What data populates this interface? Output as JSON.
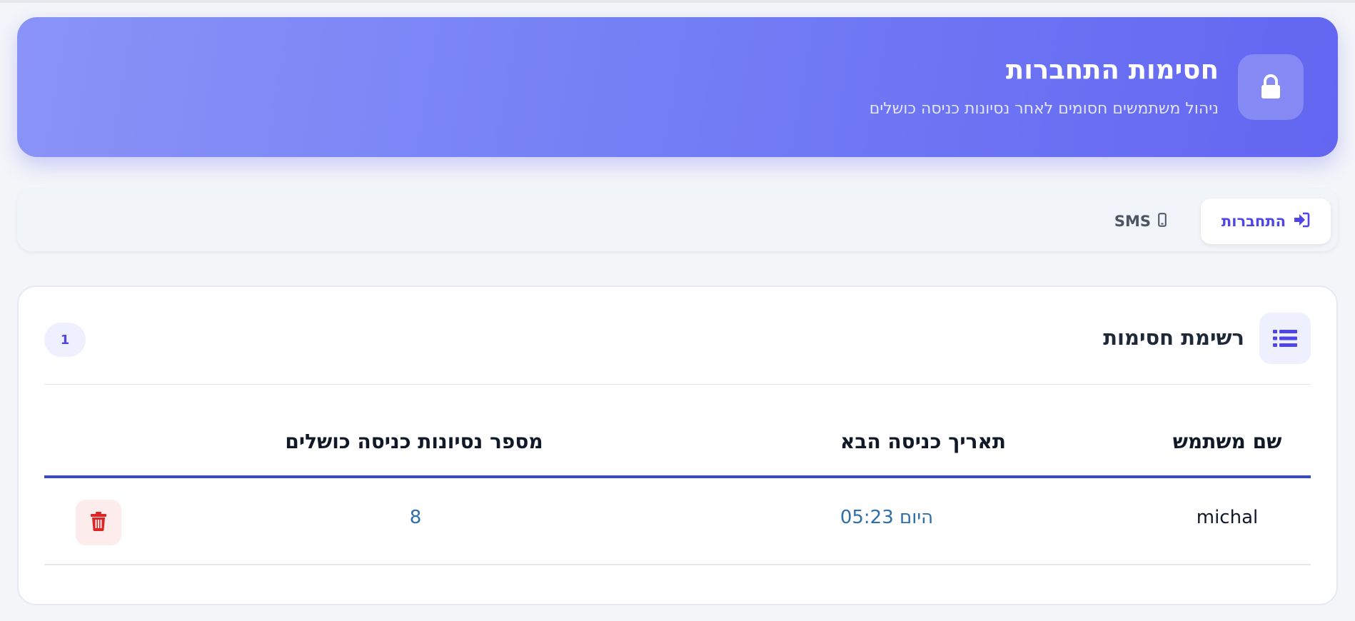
{
  "header": {
    "title": "חסימות התחברות",
    "subtitle": "ניהול משתמשים חסומים לאחר נסיונות כניסה כושלים",
    "icon": "lock-icon"
  },
  "tabs": [
    {
      "label": "התחברות",
      "icon": "sign-in-icon",
      "active": true
    },
    {
      "label": "SMS",
      "icon": "mobile-icon",
      "active": false
    }
  ],
  "list": {
    "title": "רשימת חסימות",
    "icon": "list-icon",
    "count": "1",
    "columns": [
      "שם משתמש",
      "תאריך כניסה הבא",
      "מספר נסיונות כניסה כושלים"
    ],
    "rows": [
      {
        "username": "michal",
        "next_login": "היום 05:23",
        "failed_attempts": "8"
      }
    ]
  },
  "colors": {
    "accent": "#6366f1",
    "table_rule": "#3b4cb8",
    "link_value": "#2f6fa8",
    "danger": "#dc2626"
  }
}
